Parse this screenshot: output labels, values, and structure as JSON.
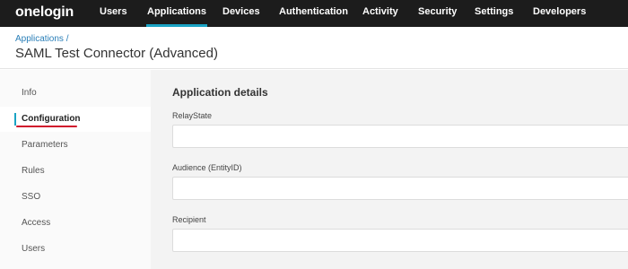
{
  "nav": {
    "logo": "onelogin",
    "items": [
      {
        "label": "Users"
      },
      {
        "label": "Applications"
      },
      {
        "label": "Devices"
      },
      {
        "label": "Authentication"
      },
      {
        "label": "Activity"
      },
      {
        "label": "Security"
      },
      {
        "label": "Settings"
      },
      {
        "label": "Developers"
      }
    ],
    "active": "Applications"
  },
  "header": {
    "breadcrumb": "Applications /",
    "title": "SAML Test Connector (Advanced)"
  },
  "sidebar": {
    "items": [
      {
        "label": "Info"
      },
      {
        "label": "Configuration"
      },
      {
        "label": "Parameters"
      },
      {
        "label": "Rules"
      },
      {
        "label": "SSO"
      },
      {
        "label": "Access"
      },
      {
        "label": "Users"
      }
    ],
    "active": "Configuration"
  },
  "main": {
    "section_title": "Application details",
    "fields": [
      {
        "label": "RelayState",
        "value": ""
      },
      {
        "label": "Audience (EntityID)",
        "value": ""
      },
      {
        "label": "Recipient",
        "value": ""
      }
    ]
  },
  "colors": {
    "nav_bg": "#1c1c1c",
    "accent": "#1aa3c4",
    "annotation_underline": "#d0142c"
  }
}
